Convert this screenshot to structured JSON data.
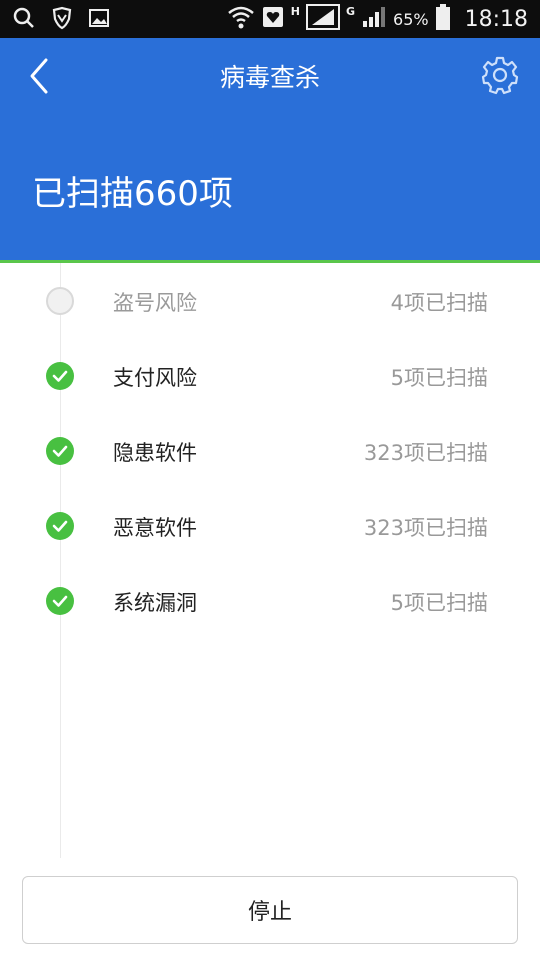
{
  "status_bar": {
    "battery_percent": "65%",
    "time": "18:18",
    "network_h": "H",
    "network_g": "G",
    "icons": [
      "search-icon",
      "shield-icon",
      "image-icon",
      "wifi-icon",
      "heart-icon",
      "signal-icon",
      "battery-icon"
    ]
  },
  "header": {
    "title": "病毒查杀",
    "scanned_summary": "已扫描660项",
    "background_color": "#2a6fd8",
    "accent_line_color": "#5ac64b"
  },
  "scan_items": [
    {
      "name": "盗号风险",
      "count": "4项已扫描",
      "status": "scanning"
    },
    {
      "name": "支付风险",
      "count": "5项已扫描",
      "status": "done"
    },
    {
      "name": "隐患软件",
      "count": "323项已扫描",
      "status": "done"
    },
    {
      "name": "恶意软件",
      "count": "323项已扫描",
      "status": "done"
    },
    {
      "name": "系统漏洞",
      "count": "5项已扫描",
      "status": "done"
    }
  ],
  "stop_button": {
    "label": "停止"
  }
}
